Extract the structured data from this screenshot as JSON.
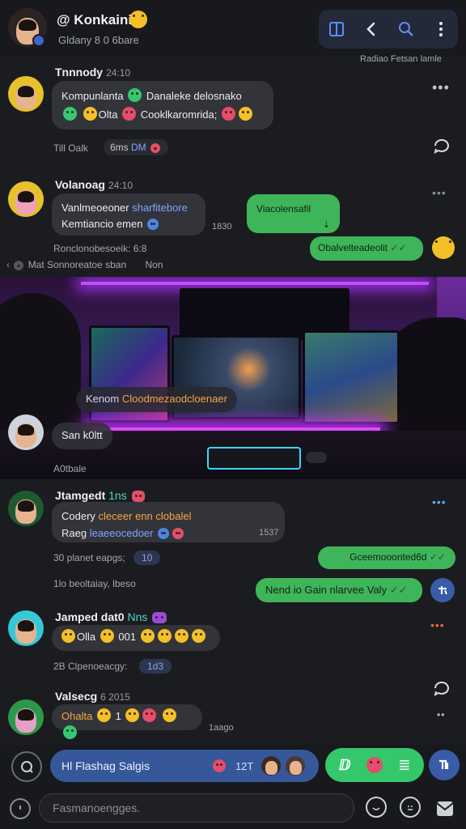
{
  "header": {
    "title": "@ Konkaini",
    "subtitle": "Gldany 8 0 6bare",
    "link_text": "Radiao Fetsan lamle"
  },
  "messages": {
    "m1": {
      "sender": "Tnnnody",
      "time": "24:10",
      "line1": "Kompunlanta",
      "line1b": "Danaleke delosnako",
      "line2a": "Olta",
      "line2b": "Cooklkaromrida;",
      "meta": "Till Oalk",
      "pill": "6ms",
      "pill2": "DM"
    },
    "m2": {
      "sender": "Volanoag",
      "time": "24:10",
      "line1a": "Vanlmeoeoner",
      "line1b": "sharfitebore",
      "line2": "Kemtiancio emen",
      "reply": "Viacolensafil",
      "reply_time": "1830",
      "meta": "Ronclonobesoeik: 6:8",
      "green2": "Obalvelteadeolit",
      "thread": "Sonnoreatoe sban",
      "thread_prefix": "Mat",
      "thread_suffix": "Non"
    },
    "m3": {
      "overlay_label": "Kenom",
      "overlay_text": "Cloodmezaodcloenaer",
      "sender_bubble": "San k0ltt",
      "meta": "A0tbale"
    },
    "m4": {
      "sender": "Jtamgedt",
      "badge": "1ns",
      "line1a": "Codery",
      "line1b": "cleceer enn clobalel",
      "line2a": "Raeg",
      "line2b": "leaeeocedoer",
      "time": "1537",
      "meta": "30 planet eapgs;",
      "pill": "10",
      "green1": "Gceemooonted",
      "green1b": "6d",
      "meta2": "1lo beoltaiay, lbeso",
      "green2": "Nend io Gain nlarvee Valy"
    },
    "m5": {
      "sender": "Jamped dat0",
      "badge": "Nns",
      "line_a": "Olla",
      "line_b": "001",
      "meta": "2B Clpenoeacgy:",
      "pill": "1d3"
    },
    "m6": {
      "sender": "Valsecg",
      "time": "6 2015",
      "line_a": "Ohalta",
      "line_b": "1",
      "time2": "1aago"
    }
  },
  "composer": {
    "input_text": "Hl Flashag Salgis",
    "input_count": "12T",
    "bottom_placeholder": "Fasmanoengges."
  },
  "colors": {
    "accent_green": "#3fb55a",
    "accent_blue": "#36589a",
    "bubble": "#33343a",
    "background": "#1b1c20"
  },
  "icons": [
    "panel-icon",
    "back-icon",
    "search-icon",
    "more-icon",
    "reply-icon",
    "emoji-icon",
    "mic-icon",
    "send-icon",
    "gift-icon",
    "attach-icon",
    "clock-icon",
    "sticker-icon"
  ]
}
